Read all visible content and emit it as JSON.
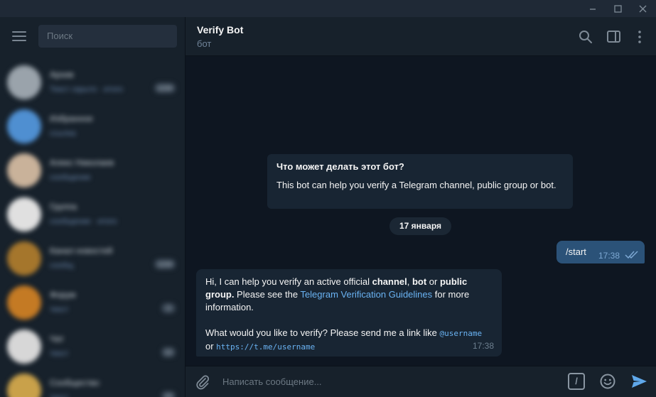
{
  "window": {
    "minimize_icon": "minimize-icon",
    "maximize_icon": "maximize-icon",
    "close_icon": "close-icon"
  },
  "sidebar": {
    "search_placeholder": "Поиск",
    "chats": [
      {
        "title": "Архив",
        "subtitle": "Текст скрыто · итого",
        "badge": "1234",
        "avatar_color": "#9aa3ab"
      },
      {
        "title": "Избранное",
        "subtitle": "ссылка",
        "badge": "",
        "avatar_color": "#4f8fd1"
      },
      {
        "title": "Алекс Николаев",
        "subtitle": "сообщение",
        "badge": "",
        "avatar_color": "#c9b29a"
      },
      {
        "title": "Группа",
        "subtitle": "сообщение · итого",
        "badge": "",
        "avatar_color": "#e0e0e0"
      },
      {
        "title": "Канал новостей",
        "subtitle": "сообщ",
        "badge": "1234",
        "avatar_color": "#a5762c"
      },
      {
        "title": "Форум",
        "subtitle": "текст",
        "badge": "3",
        "avatar_color": "#c47a24"
      },
      {
        "title": "Чат",
        "subtitle": "текст",
        "badge": "12",
        "avatar_color": "#d7d7d7"
      },
      {
        "title": "Сообщество",
        "subtitle": "текст",
        "badge": "10",
        "avatar_color": "#c9a14a"
      }
    ]
  },
  "header": {
    "title": "Verify Bot",
    "subtitle": "бот"
  },
  "about": {
    "title": "Что может делать этот бот?",
    "text": "This bot can help you verify a Telegram channel, public group or bot."
  },
  "date_separator": "17 января",
  "outgoing": {
    "text": "/start",
    "time": "17:38"
  },
  "incoming": {
    "p1_a": "Hi, I can help you verify an active official ",
    "p1_b": "channel",
    "p1_c": ", ",
    "p1_d": "bot",
    "p1_e": " or ",
    "p1_f": "public group.",
    "p1_g": " Please see the ",
    "p1_link": "Telegram Verification Guidelines",
    "p1_h": " for more information.",
    "p2_a": "What would you like to verify? Please send me a link like ",
    "p2_code1": "@username",
    "p2_b": "or ",
    "p2_code2": "https://t.me/username",
    "time": "17:38"
  },
  "composer": {
    "placeholder": "Написать сообщение...",
    "command_label": "/"
  },
  "colors": {
    "accent": "#6ab3f3",
    "outgoing_bubble": "#2b5278",
    "incoming_bubble": "#182533",
    "background": "#0e1621"
  }
}
